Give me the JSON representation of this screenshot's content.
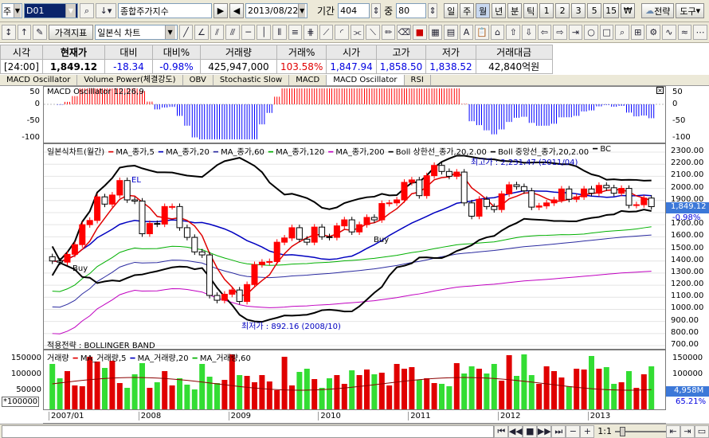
{
  "toolbar1": {
    "type_label": "주",
    "code": "D01",
    "name": "종합주가지수",
    "date": "2013/08/22",
    "period_label": "기간",
    "period_value": "404",
    "mid_label": "중",
    "mid_value": "80",
    "periods": [
      "일",
      "주",
      "월",
      "년",
      "분",
      "틱",
      "1",
      "2",
      "3",
      "5",
      "15"
    ],
    "won_btn": "₩",
    "strategy_btn": "전략",
    "tools_btn": "도구"
  },
  "toolbar2": {
    "indicator_btn": "가격지표",
    "chart_type": "일본식 차트"
  },
  "quote": {
    "headers": [
      "시각",
      "현재가",
      "대비",
      "대비%",
      "거래량",
      "거래%",
      "시가",
      "고가",
      "저가",
      "거래대금"
    ],
    "values": [
      "[24:00]",
      "1,849.12",
      "-18.34",
      "-0.98%",
      "425,947,000",
      "103.58%",
      "1,847.94",
      "1,858.50",
      "1,838.52",
      "42,840억원"
    ]
  },
  "tabs": [
    "MACD Oscillator",
    "Volume Power(체결강도)",
    "OBV",
    "Stochastic Slow",
    "MACD",
    "MACD Oscillator",
    "RSI"
  ],
  "active_tab_index": 5,
  "macd": {
    "legend": "MACD Oscillator 12,26,9",
    "left_ticks": [
      "50",
      "0",
      "-50",
      "-100"
    ],
    "right_ticks": [
      "50",
      "0",
      "-50",
      "-100"
    ]
  },
  "price": {
    "legend": [
      "일본식차트(월간)",
      "MA_종가,5",
      "MA_종가,20",
      "MA_종가,60",
      "MA_종가,120",
      "MA_종가,200",
      "Boll 상한선_종가,20,2.00",
      "Boll 중앙선_종가,20,2.00",
      "BC"
    ],
    "ticks": [
      "2300.00",
      "2200.00",
      "2100.00",
      "2000.00",
      "1900.00",
      "1800.00",
      "1700.00",
      "1600.00",
      "1500.00",
      "1400.00",
      "1300.00",
      "1200.00",
      "1100.00",
      "1000.00",
      "900.00",
      "800.00",
      "700.00"
    ],
    "current_price": "1,849.12",
    "current_pct": "-0.98%",
    "max_note": "최고가 : 2,231.47 (2011/04)",
    "min_note": "최저가 : 892.16 (2008/10)",
    "sell_label": "EL",
    "buy_labels": [
      "Buy",
      "Buy"
    ],
    "strategy_note": "적용전략 : BOLLINGER BAND"
  },
  "volume": {
    "legend": [
      "거래량",
      "MA_거래량,5",
      "MA_거래량,20",
      "MA_거래량,60"
    ],
    "left_ticks": [
      "150000",
      "100000",
      "50000"
    ],
    "unit": "*100000",
    "right_ticks": [
      "150000",
      "100000",
      "50000"
    ],
    "current_volume": "4,958M",
    "current_pct": "65.21%"
  },
  "x_axis": [
    "2007/01",
    "2008",
    "2009",
    "2010",
    "2011",
    "2012",
    "2013"
  ],
  "bottom": {
    "scale": "1:1"
  },
  "colors": {
    "up": "#ff0000",
    "down": "#0000ff",
    "ma5": "#e00000",
    "ma20": "#0000c0",
    "ma60": "#00b000",
    "ma120": "#2a2aa0",
    "ma200": "#c000c0",
    "boll": "#000000"
  },
  "chart_data": {
    "type": "candlestick",
    "interval": "monthly",
    "start": "2007/01",
    "ylim": [
      700,
      2300
    ],
    "candles": [
      [
        1435,
        1400
      ],
      [
        1400,
        1390
      ],
      [
        1390,
        1455
      ],
      [
        1455,
        1535
      ],
      [
        1535,
        1700
      ],
      [
        1700,
        1735
      ],
      [
        1735,
        1930
      ],
      [
        1930,
        1870
      ],
      [
        1870,
        1945
      ],
      [
        1945,
        2065
      ],
      [
        2065,
        1905
      ],
      [
        1905,
        1895
      ],
      [
        1895,
        1625
      ],
      [
        1625,
        1710
      ],
      [
        1710,
        1705
      ],
      [
        1705,
        1850
      ],
      [
        1850,
        1850
      ],
      [
        1850,
        1675
      ],
      [
        1675,
        1595
      ],
      [
        1595,
        1475
      ],
      [
        1475,
        1450
      ],
      [
        1450,
        1115
      ],
      [
        1115,
        1075
      ],
      [
        1075,
        1125
      ],
      [
        1125,
        1160
      ],
      [
        1160,
        1065
      ],
      [
        1065,
        1205
      ],
      [
        1205,
        1370
      ],
      [
        1370,
        1390
      ],
      [
        1390,
        1395
      ],
      [
        1395,
        1555
      ],
      [
        1555,
        1590
      ],
      [
        1590,
        1675
      ],
      [
        1675,
        1580
      ],
      [
        1580,
        1555
      ],
      [
        1555,
        1680
      ],
      [
        1680,
        1600
      ],
      [
        1600,
        1595
      ],
      [
        1595,
        1690
      ],
      [
        1690,
        1740
      ],
      [
        1740,
        1640
      ],
      [
        1640,
        1700
      ],
      [
        1700,
        1760
      ],
      [
        1760,
        1740
      ],
      [
        1740,
        1875
      ],
      [
        1875,
        1880
      ],
      [
        1880,
        1905
      ],
      [
        1905,
        2050
      ],
      [
        2050,
        2070
      ],
      [
        2070,
        1940
      ],
      [
        1940,
        2105
      ],
      [
        2105,
        2190
      ],
      [
        2190,
        2140
      ],
      [
        2140,
        2100
      ],
      [
        2100,
        2135
      ],
      [
        2135,
        1880
      ],
      [
        1880,
        1770
      ],
      [
        1770,
        1910
      ],
      [
        1910,
        1850
      ],
      [
        1850,
        1825
      ],
      [
        1825,
        1955
      ],
      [
        1955,
        2030
      ],
      [
        2030,
        2015
      ],
      [
        2015,
        1980
      ],
      [
        1980,
        1845
      ],
      [
        1845,
        1855
      ],
      [
        1855,
        1880
      ],
      [
        1880,
        1905
      ],
      [
        1905,
        1995
      ],
      [
        1995,
        1910
      ],
      [
        1910,
        1930
      ],
      [
        1930,
        1995
      ],
      [
        1995,
        1960
      ],
      [
        1960,
        2025
      ],
      [
        2025,
        2005
      ],
      [
        2005,
        1960
      ],
      [
        1960,
        2000
      ],
      [
        2000,
        1860
      ],
      [
        1860,
        1865
      ],
      [
        1865,
        1920
      ],
      [
        1920,
        1849
      ]
    ]
  }
}
